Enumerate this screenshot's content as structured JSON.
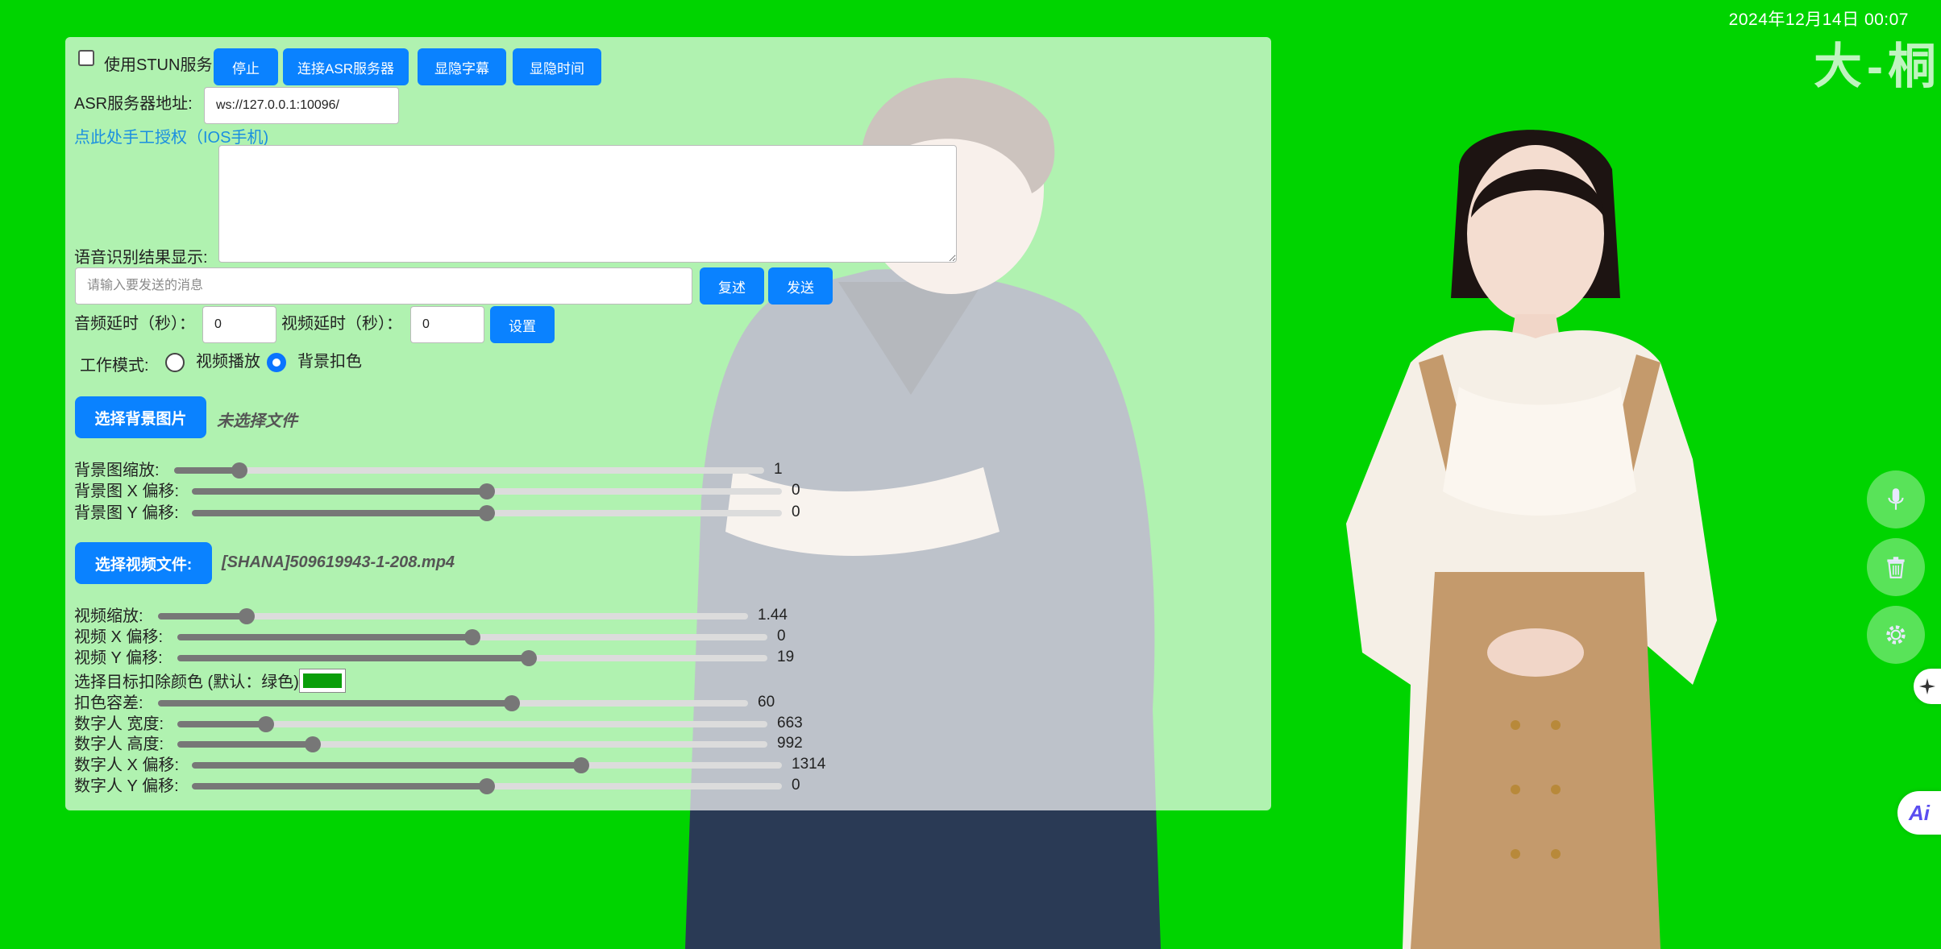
{
  "overlay": {
    "datetime": "2024年12月14日  00:07",
    "brand": "大-桐"
  },
  "top_bar": {
    "stun_label": "使用STUN服务",
    "stun_checked": false,
    "stop_label": "停止",
    "connect_asr_label": "连接ASR服务器",
    "toggle_subtitle_label": "显隐字幕",
    "toggle_time_label": "显隐时间"
  },
  "asr": {
    "label": "ASR服务器地址:",
    "value": "ws://127.0.0.1:10096/"
  },
  "auth_link": "点此处手工授权（IOS手机)",
  "recognition": {
    "label": "语音识别结果显示:",
    "value": ""
  },
  "message": {
    "placeholder": "请输入要发送的消息",
    "repeat_label": "复述",
    "send_label": "发送"
  },
  "delay": {
    "audio_label": "音频延时（秒）：",
    "audio_value": "0",
    "video_label": "视频延时（秒）：",
    "video_value": "0",
    "set_label": "设置"
  },
  "mode": {
    "label": "工作模式:",
    "options": [
      "视频播放",
      "背景扣色"
    ],
    "selected": "背景扣色"
  },
  "background": {
    "button_label": "选择背景图片",
    "file_name": "未选择文件",
    "sliders": [
      {
        "label": "背景图缩放:",
        "value": "1",
        "fraction": 0.11
      },
      {
        "label": "背景图 X 偏移:",
        "value": "0",
        "fraction": 0.5
      },
      {
        "label": "背景图 Y 偏移:",
        "value": "0",
        "fraction": 0.5
      }
    ]
  },
  "video": {
    "button_label": "选择视频文件:",
    "file_name": "[SHANA]509619943-1-208.mp4",
    "sliders": [
      {
        "label": "视频缩放:",
        "value": "1.44",
        "fraction": 0.15
      },
      {
        "label": "视频 X 偏移:",
        "value": "0",
        "fraction": 0.5
      },
      {
        "label": "视频 Y 偏移:",
        "value": "19",
        "fraction": 0.595
      }
    ]
  },
  "keying": {
    "color_label": "选择目标扣除颜色 (默认：绿色):",
    "color_value": "#0a9e0a",
    "sliders": [
      {
        "label": "扣色容差:",
        "value": "60",
        "fraction": 0.6
      },
      {
        "label": "数字人 宽度:",
        "value": "663",
        "fraction": 0.15
      },
      {
        "label": "数字人 高度:",
        "value": "992",
        "fraction": 0.23
      },
      {
        "label": "数字人 X 偏移:",
        "value": "1314",
        "fraction": 0.66
      },
      {
        "label": "数字人 Y 偏移:",
        "value": "0",
        "fraction": 0.5
      }
    ]
  },
  "side_icons": [
    "microphone-icon",
    "trash-icon",
    "settings-icon",
    "sparkle-icon",
    "ai-icon"
  ],
  "ai_label": "Ai",
  "colors": {
    "accent": "#0a82ff",
    "chroma_green": "#00d400",
    "link": "#1a8fe0"
  }
}
